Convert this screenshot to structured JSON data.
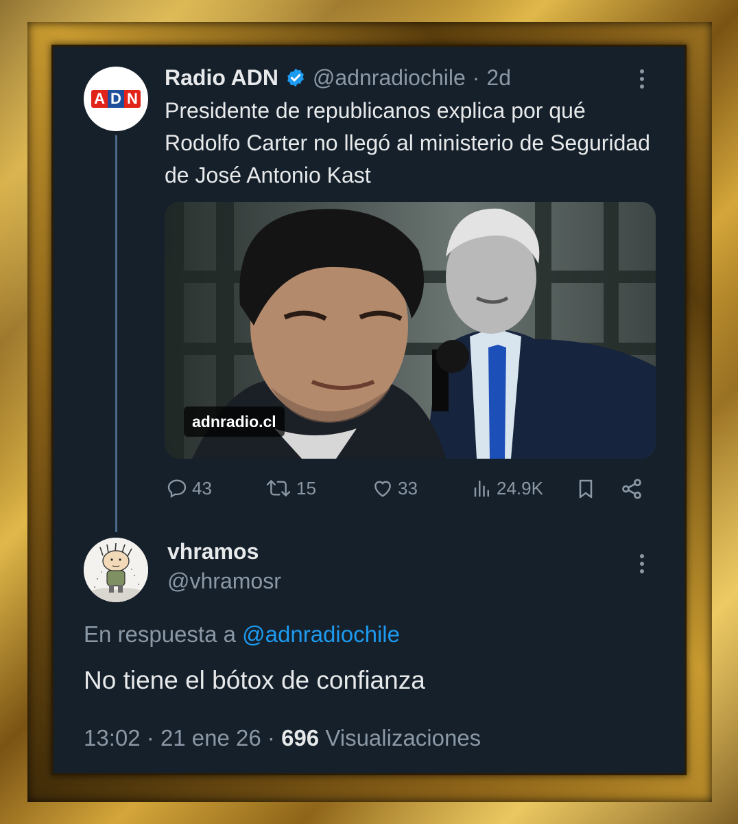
{
  "original_tweet": {
    "display_name": "Radio ADN",
    "handle": "@adnradiochile",
    "separator": "·",
    "age": "2d",
    "avatar_logo_letters": [
      "A",
      "D",
      "N"
    ],
    "text": "Presidente de republicanos explica por qué Rodolfo Carter no llegó al ministerio de Seguridad de José Antonio Kast",
    "media_source": "adnradio.cl",
    "stats": {
      "replies": "43",
      "reposts": "15",
      "likes": "33",
      "views": "24.9K"
    },
    "icons": [
      "verified-badge-icon",
      "more-icon",
      "reply-icon",
      "repost-icon",
      "like-icon",
      "views-icon",
      "bookmark-icon",
      "share-icon"
    ]
  },
  "reply_tweet": {
    "display_name": "vhramos",
    "handle": "@vhramosr",
    "replying_to_prefix": "En respuesta a",
    "replying_to_handle": "@adnradiochile",
    "text": "No tiene el bótox de confianza",
    "time": "13:02",
    "date": "21 ene 26",
    "views_count": "696",
    "views_label": "Visualizaciones"
  },
  "colors": {
    "background": "#15202b",
    "text": "#e7e9ea",
    "muted": "#8b98a5",
    "link": "#1d9bf0",
    "verified": "#1d9bf0",
    "logo_red": "#e2231a",
    "logo_blue": "#1f4e9c"
  }
}
